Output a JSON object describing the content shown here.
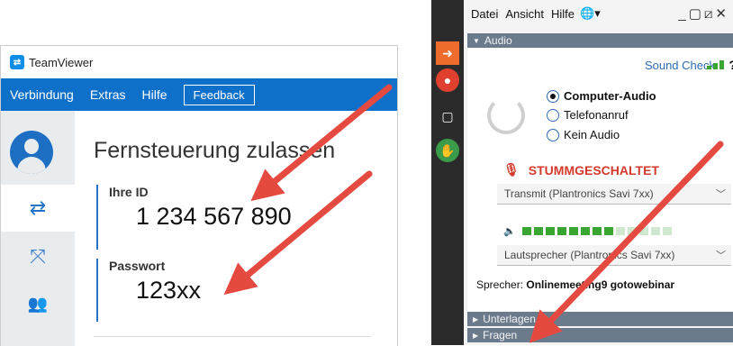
{
  "teamviewer": {
    "app_title": "TeamViewer",
    "menu": [
      "Verbindung",
      "Extras",
      "Hilfe"
    ],
    "feedback_label": "Feedback",
    "heading": "Fernsteuerung zulassen",
    "id_label": "Ihre ID",
    "id_value": "1 234 567 890",
    "password_label": "Passwort",
    "password_value": "123xx",
    "nav_icons": [
      "avatar-icon",
      "arrows-icon",
      "fullscreen-icon",
      "people-icon"
    ]
  },
  "gotowebinar": {
    "menu": [
      "Datei",
      "Ansicht",
      "Hilfe"
    ],
    "audio_section_label": "Audio",
    "sound_check_label": "Sound Check",
    "help_label": "?",
    "radio_options": [
      {
        "label": "Computer-Audio",
        "selected": true
      },
      {
        "label": "Telefonanruf",
        "selected": false
      },
      {
        "label": "Kein Audio",
        "selected": false
      }
    ],
    "muted_label": "STUMMGESCHALTET",
    "transmit_device": "Transmit (Plantronics Savi 7xx)",
    "speaker_device": "Lautsprecher (Plantronics Savi 7xx)",
    "speaker_label": "Sprecher:",
    "speaker_name": "Onlinemeeting9 gotowebinar",
    "section_handouts": "Unterlagen",
    "section_questions": "Fragen"
  },
  "colors": {
    "teamviewer_blue": "#0e70c9",
    "accent_red": "#e44a3f",
    "mute_red": "#d43a2c",
    "meter_green": "#3aa632"
  }
}
